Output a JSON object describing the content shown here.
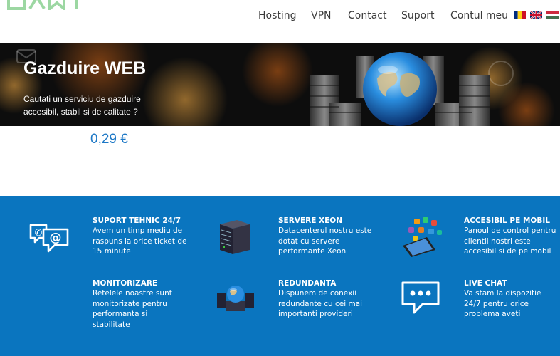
{
  "nav": {
    "items": [
      {
        "label": "Hosting"
      },
      {
        "label": "VPN"
      },
      {
        "label": "Contact"
      },
      {
        "label": "Suport"
      },
      {
        "label": "Contul meu"
      }
    ]
  },
  "languages": [
    "ro-flag-icon",
    "uk-flag-icon",
    "hu-flag-icon"
  ],
  "banner": {
    "title": "Gazduire WEB",
    "subtitle": "Cautati un serviciu de gazduire accesibil, stabil si de calitate ?"
  },
  "price": "0,29 €",
  "colors": {
    "features_bg": "#0a75bf",
    "price": "#1d78c6",
    "nav_text": "#3a3a3a"
  },
  "features": [
    {
      "icon": "chat-mail-icon",
      "title": "SUPORT TEHNIC 24/7",
      "text": "Avem un timp mediu de raspuns la orice ticket de 15 minute"
    },
    {
      "icon": "server-rack-icon",
      "title": "SERVERE XEON",
      "text": "Datacenterul nostru este dotat cu servere performante Xeon"
    },
    {
      "icon": "mobile-phone-icon",
      "title": "ACCESIBIL PE MOBIL",
      "text": "Panoul de control pentru clientii nostri este accesibil si de pe mobil"
    },
    {
      "icon": "",
      "title": "MONITORIZARE",
      "text": "Retelele noastre sunt monitorizate pentru performanta si stabilitate"
    },
    {
      "icon": "network-globe-icon",
      "title": "REDUNDANTA",
      "text": "Dispunem de conexii redundante cu cei mai importanti provideri"
    },
    {
      "icon": "live-chat-icon",
      "title": "LIVE CHAT",
      "text": "Va stam la dispozitie 24/7 pentru orice problema aveti"
    }
  ]
}
